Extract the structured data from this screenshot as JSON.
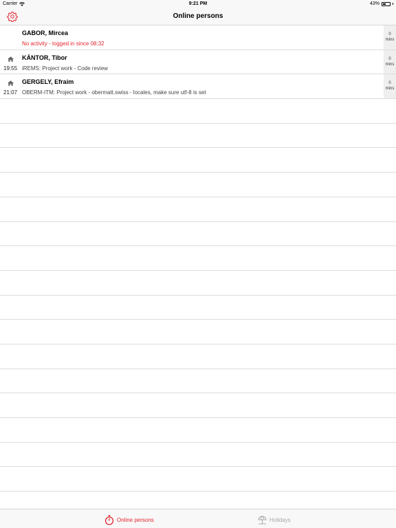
{
  "status_bar": {
    "carrier": "Carrier",
    "time": "9:21 PM",
    "battery_percent": "43%",
    "battery_level": 0.43
  },
  "nav": {
    "title": "Online persons",
    "settings_icon": "gear-icon"
  },
  "rows": [
    {
      "name": "GABOR, Mircea",
      "detail": "No activity - logged in since 08:32",
      "detail_warning": true,
      "time": "",
      "location_icon": "",
      "mins_value": "0",
      "mins_unit": "mins"
    },
    {
      "name": "KÁNTOR, Tibor",
      "detail": "iREMS: Project work - Code review",
      "detail_warning": false,
      "time": "19:55",
      "location_icon": "home-icon",
      "mins_value": "0",
      "mins_unit": "mins"
    },
    {
      "name": "GERGELY, Efraim",
      "detail": "OBERM-ITM: Project work - obermatt.swiss - locales, make sure utf-8 is set",
      "detail_warning": false,
      "time": "21:07",
      "location_icon": "home-icon",
      "mins_value": "0",
      "mins_unit": "mins"
    }
  ],
  "empty_row_count": 17,
  "tabs": [
    {
      "label": "Online persons",
      "icon": "stopwatch-icon",
      "active": true
    },
    {
      "label": "Holidays",
      "icon": "beach-umbrella-icon",
      "active": false
    }
  ],
  "colors": {
    "accent": "#e3262f",
    "inactive": "#a8a8a8",
    "bar_background": "#f8f8f8"
  }
}
